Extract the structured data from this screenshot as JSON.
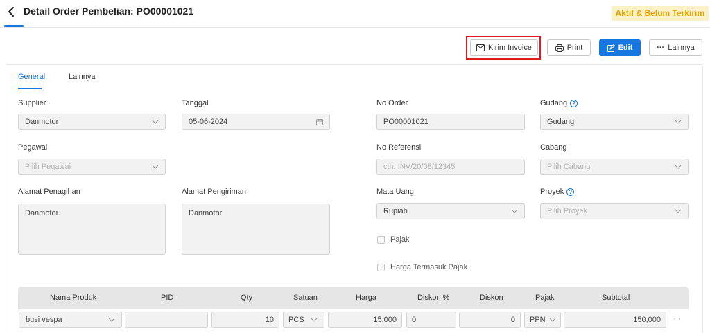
{
  "header": {
    "title": "Detail Order Pembelian: PO00001021",
    "status": "Aktif & Belum Terkirim"
  },
  "toolbar": {
    "send_invoice": "Kirim Invoice",
    "print": "Print",
    "edit": "Edit",
    "more": "Lainnya"
  },
  "tabs": [
    "General",
    "Lainnya"
  ],
  "form": {
    "supplier": {
      "label": "Supplier",
      "value": "Danmotor"
    },
    "tanggal": {
      "label": "Tanggal",
      "value": "05-06-2024"
    },
    "no_order": {
      "label": "No Order",
      "value": "PO00001021"
    },
    "gudang": {
      "label": "Gudang",
      "value": "Gudang"
    },
    "pegawai": {
      "label": "Pegawai",
      "placeholder": "Pilih Pegawai"
    },
    "no_referensi": {
      "label": "No Referensi",
      "placeholder": "cth. INV/20/08/12345"
    },
    "cabang": {
      "label": "Cabang",
      "placeholder": "Pilih Cabang"
    },
    "alamat_penagihan": {
      "label": "Alamat Penagihan",
      "value": "Danmotor"
    },
    "alamat_pengiriman": {
      "label": "Alamat Pengiriman",
      "value": "Danmotor"
    },
    "mata_uang": {
      "label": "Mata Uang",
      "value": "Rupiah"
    },
    "proyek": {
      "label": "Proyek",
      "placeholder": "Pilih Proyek"
    },
    "pajak_checkbox": "Pajak",
    "harga_termasuk_pajak": "Harga Termasuk Pajak"
  },
  "table": {
    "headers": [
      "Nama Produk",
      "PID",
      "Qty",
      "Satuan",
      "Harga",
      "Diskon %",
      "Diskon",
      "Pajak",
      "Subtotal"
    ],
    "rows": [
      {
        "produk": "busi vespa",
        "pid": "",
        "qty": "10",
        "satuan": "PCS",
        "harga": "15,000",
        "diskon_pct": "0",
        "diskon": "0",
        "pajak": "PPN",
        "subtotal": "150,000"
      }
    ],
    "row_more": "···"
  },
  "colors": {
    "accent": "#1677e0",
    "status_text": "#e8a100",
    "status_bg": "#fdf1c6",
    "highlight": "#e11b1b"
  }
}
